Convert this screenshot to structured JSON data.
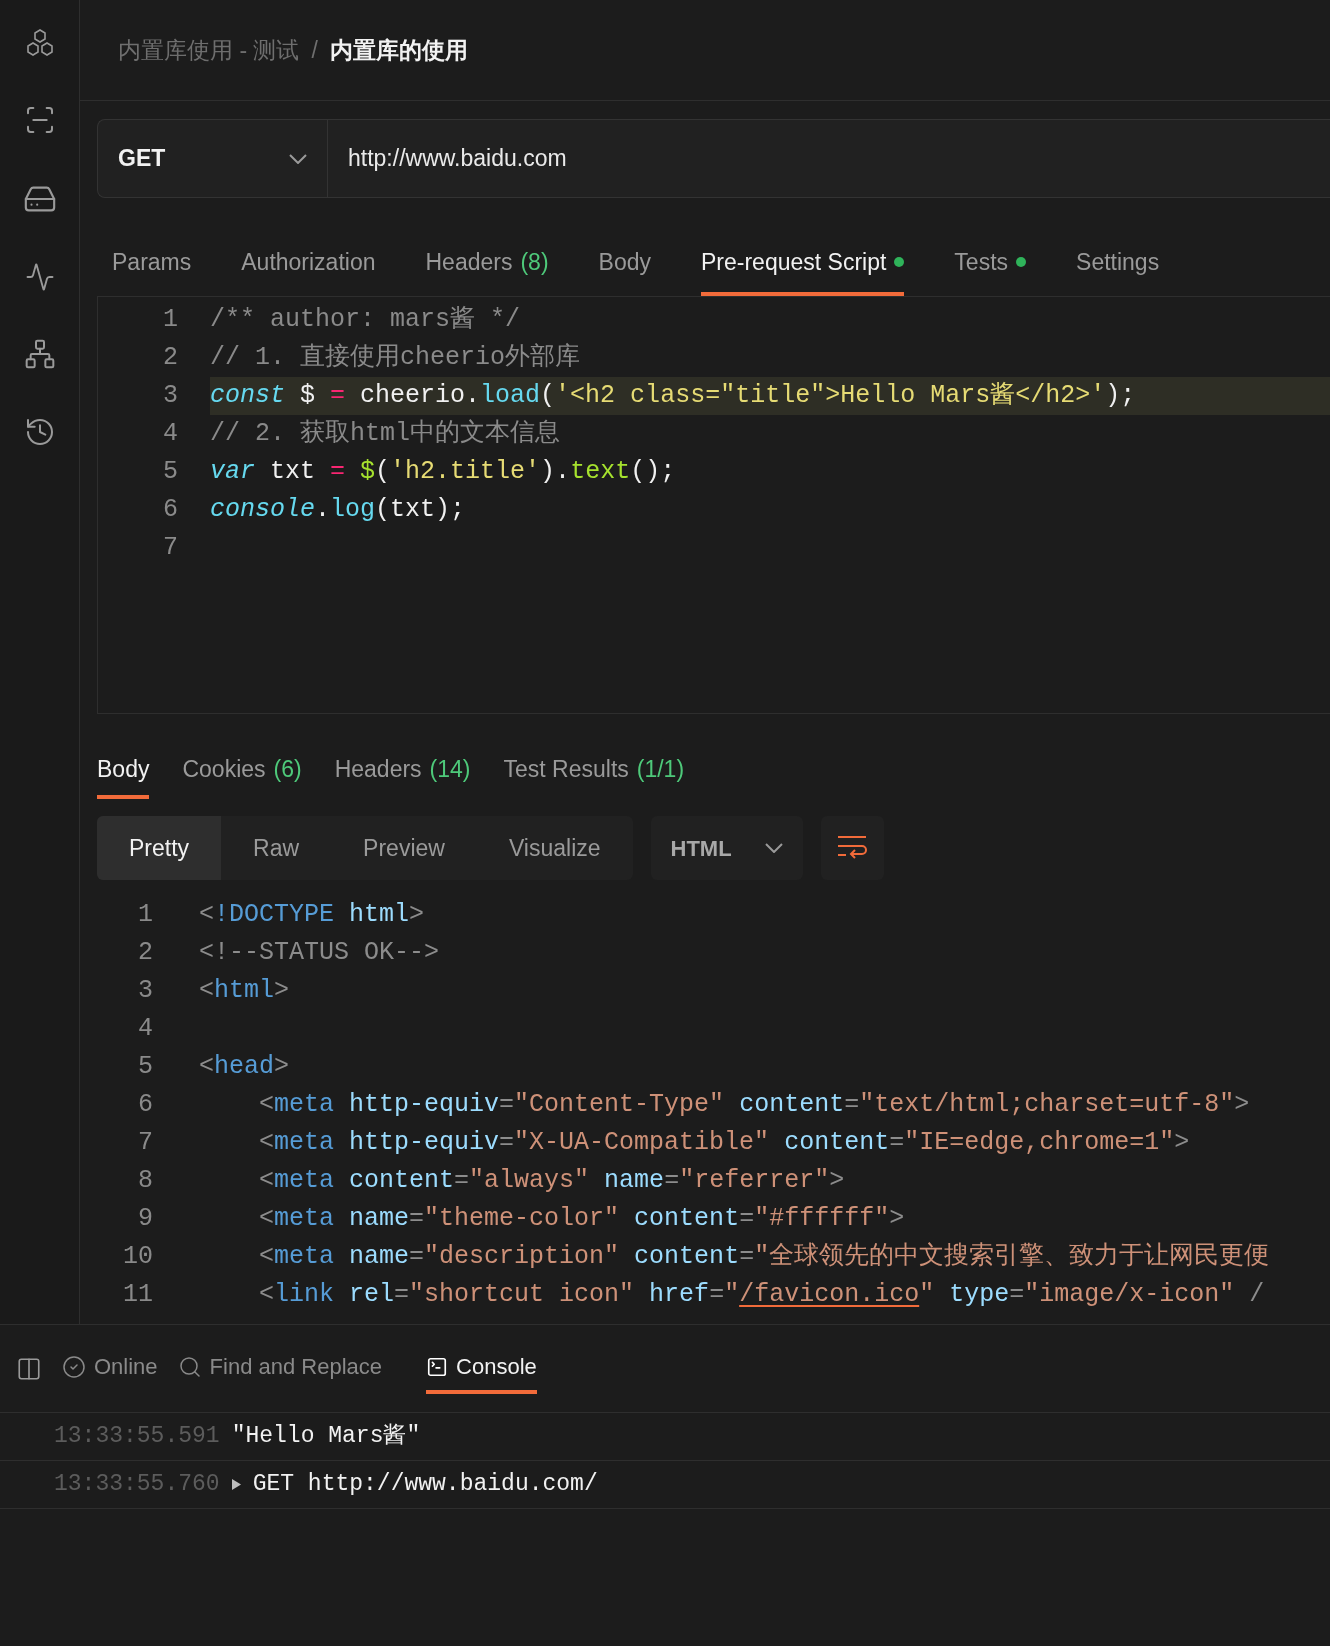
{
  "breadcrumb": {
    "parent": "内置库使用 - 测试",
    "separator": "/",
    "current": "内置库的使用"
  },
  "request": {
    "method": "GET",
    "url": "http://www.baidu.com"
  },
  "request_tabs": [
    {
      "label": "Params",
      "dot": false,
      "selected": false
    },
    {
      "label": "Authorization",
      "dot": false,
      "selected": false
    },
    {
      "label": "Headers",
      "count": "(8)",
      "dot": false,
      "selected": false
    },
    {
      "label": "Body",
      "dot": false,
      "selected": false
    },
    {
      "label": "Pre-request Script",
      "dot": true,
      "selected": true
    },
    {
      "label": "Tests",
      "dot": true,
      "selected": false
    },
    {
      "label": "Settings",
      "dot": false,
      "selected": false
    }
  ],
  "script_editor": {
    "lines": [
      {
        "number": "1",
        "current": false,
        "tokens": [
          {
            "kind": "comment",
            "text": "/** author: mars酱 */"
          }
        ]
      },
      {
        "number": "2",
        "current": false,
        "tokens": [
          {
            "kind": "comment",
            "text": "// 1. 直接使用cheerio外部库"
          }
        ]
      },
      {
        "number": "3",
        "current": true,
        "tokens": [
          {
            "kind": "keyword",
            "text": "const"
          },
          {
            "kind": "plain",
            "text": " $ "
          },
          {
            "kind": "operator",
            "text": "="
          },
          {
            "kind": "plain",
            "text": " cheerio."
          },
          {
            "kind": "function",
            "text": "load"
          },
          {
            "kind": "plain",
            "text": "("
          },
          {
            "kind": "string",
            "text": "'<h2 class=\"title\">Hello Mars酱</h2>'"
          },
          {
            "kind": "plain",
            "text": ");"
          }
        ]
      },
      {
        "number": "4",
        "current": false,
        "tokens": [
          {
            "kind": "comment",
            "text": "// 2. 获取html中的文本信息"
          }
        ]
      },
      {
        "number": "5",
        "current": false,
        "tokens": [
          {
            "kind": "keyword",
            "text": "var"
          },
          {
            "kind": "plain",
            "text": " txt "
          },
          {
            "kind": "operator",
            "text": "="
          },
          {
            "kind": "method",
            "text": " $"
          },
          {
            "kind": "plain",
            "text": "("
          },
          {
            "kind": "string",
            "text": "'h2.title'"
          },
          {
            "kind": "plain",
            "text": ")."
          },
          {
            "kind": "method",
            "text": "text"
          },
          {
            "kind": "plain",
            "text": "();"
          }
        ]
      },
      {
        "number": "6",
        "current": false,
        "tokens": [
          {
            "kind": "keyword",
            "text": "console"
          },
          {
            "kind": "plain",
            "text": "."
          },
          {
            "kind": "function",
            "text": "log"
          },
          {
            "kind": "plain",
            "text": "(txt);"
          }
        ]
      },
      {
        "number": "7",
        "current": false
      }
    ]
  },
  "response_tabs": [
    {
      "label": "Body",
      "selected": true
    },
    {
      "label": "Cookies",
      "count": "(6)",
      "selected": false
    },
    {
      "label": "Headers",
      "count": "(14)",
      "selected": false
    },
    {
      "label": "Test Results",
      "count": "(1/1)",
      "selected": false
    }
  ],
  "view_modes": [
    {
      "label": "Pretty",
      "selected": true
    },
    {
      "label": "Raw",
      "selected": false
    },
    {
      "label": "Preview",
      "selected": false
    },
    {
      "label": "Visualize",
      "selected": false
    }
  ],
  "language": "HTML",
  "response_body": {
    "lines": [
      {
        "number": "1",
        "tokens": [
          {
            "kind": "punct",
            "text": "<"
          },
          {
            "kind": "tag",
            "text": "!DOCTYPE"
          },
          {
            "kind": "attr",
            "text": " html"
          },
          {
            "kind": "punct",
            "text": ">"
          }
        ]
      },
      {
        "number": "2",
        "tokens": [
          {
            "kind": "punct",
            "text": "<!--STATUS OK-->"
          }
        ]
      },
      {
        "number": "3",
        "tokens": [
          {
            "kind": "punct",
            "text": "<"
          },
          {
            "kind": "tag",
            "text": "html"
          },
          {
            "kind": "punct",
            "text": ">"
          }
        ]
      },
      {
        "number": "4"
      },
      {
        "number": "5",
        "tokens": [
          {
            "kind": "punct",
            "text": "<"
          },
          {
            "kind": "tag",
            "text": "head"
          },
          {
            "kind": "punct",
            "text": ">"
          }
        ]
      },
      {
        "number": "6",
        "tokens": [
          {
            "kind": "punct",
            "text": "    <"
          },
          {
            "kind": "tag",
            "text": "meta"
          },
          {
            "kind": "attr",
            "text": " http-equiv"
          },
          {
            "kind": "punct",
            "text": "="
          },
          {
            "kind": "value",
            "text": "\"Content-Type\""
          },
          {
            "kind": "attr",
            "text": " content"
          },
          {
            "kind": "punct",
            "text": "="
          },
          {
            "kind": "value",
            "text": "\"text/html;charset=utf-8\""
          },
          {
            "kind": "punct",
            "text": ">"
          }
        ]
      },
      {
        "number": "7",
        "tokens": [
          {
            "kind": "punct",
            "text": "    <"
          },
          {
            "kind": "tag",
            "text": "meta"
          },
          {
            "kind": "attr",
            "text": " http-equiv"
          },
          {
            "kind": "punct",
            "text": "="
          },
          {
            "kind": "value",
            "text": "\"X-UA-Compatible\""
          },
          {
            "kind": "attr",
            "text": " content"
          },
          {
            "kind": "punct",
            "text": "="
          },
          {
            "kind": "value",
            "text": "\"IE=edge,chrome=1\""
          },
          {
            "kind": "punct",
            "text": ">"
          }
        ]
      },
      {
        "number": "8",
        "tokens": [
          {
            "kind": "punct",
            "text": "    <"
          },
          {
            "kind": "tag",
            "text": "meta"
          },
          {
            "kind": "attr",
            "text": " content"
          },
          {
            "kind": "punct",
            "text": "="
          },
          {
            "kind": "value",
            "text": "\"always\""
          },
          {
            "kind": "attr",
            "text": " name"
          },
          {
            "kind": "punct",
            "text": "="
          },
          {
            "kind": "value",
            "text": "\"referrer\""
          },
          {
            "kind": "punct",
            "text": ">"
          }
        ]
      },
      {
        "number": "9",
        "tokens": [
          {
            "kind": "punct",
            "text": "    <"
          },
          {
            "kind": "tag",
            "text": "meta"
          },
          {
            "kind": "attr",
            "text": " name"
          },
          {
            "kind": "punct",
            "text": "="
          },
          {
            "kind": "value",
            "text": "\"theme-color\""
          },
          {
            "kind": "attr",
            "text": " content"
          },
          {
            "kind": "punct",
            "text": "="
          },
          {
            "kind": "value",
            "text": "\"#ffffff\""
          },
          {
            "kind": "punct",
            "text": ">"
          }
        ]
      },
      {
        "number": "10",
        "tokens": [
          {
            "kind": "punct",
            "text": "    <"
          },
          {
            "kind": "tag",
            "text": "meta"
          },
          {
            "kind": "attr",
            "text": " name"
          },
          {
            "kind": "punct",
            "text": "="
          },
          {
            "kind": "value",
            "text": "\"description\""
          },
          {
            "kind": "attr",
            "text": " content"
          },
          {
            "kind": "punct",
            "text": "="
          },
          {
            "kind": "value",
            "text": "\"全球领先的中文搜索引擎、致力于让网民更便"
          }
        ]
      },
      {
        "number": "11",
        "tokens": [
          {
            "kind": "punct",
            "text": "    <"
          },
          {
            "kind": "tag",
            "text": "link"
          },
          {
            "kind": "attr",
            "text": " rel"
          },
          {
            "kind": "punct",
            "text": "="
          },
          {
            "kind": "value",
            "text": "\"shortcut icon\""
          },
          {
            "kind": "attr",
            "text": " href"
          },
          {
            "kind": "punct",
            "text": "="
          },
          {
            "kind": "value",
            "text": "\""
          },
          {
            "kind": "link",
            "text": "/favicon.ico"
          },
          {
            "kind": "value",
            "text": "\""
          },
          {
            "kind": "attr",
            "text": " type"
          },
          {
            "kind": "punct",
            "text": "="
          },
          {
            "kind": "value",
            "text": "\"image/x-icon\""
          },
          {
            "kind": "punct",
            "text": " /"
          }
        ]
      }
    ]
  },
  "status_bar": {
    "items": [
      {
        "kind": "online",
        "label": "Online",
        "selected": false
      },
      {
        "kind": "find",
        "label": "Find and Replace",
        "selected": false
      },
      {
        "kind": "console",
        "label": "Console",
        "selected": true
      }
    ]
  },
  "console": {
    "entries": [
      {
        "kind": "log",
        "time": "13:33:55.591",
        "text": "\"Hello Mars酱\""
      },
      {
        "kind": "request",
        "time": "13:33:55.760",
        "text": "GET http://www.baidu.com/"
      }
    ]
  }
}
